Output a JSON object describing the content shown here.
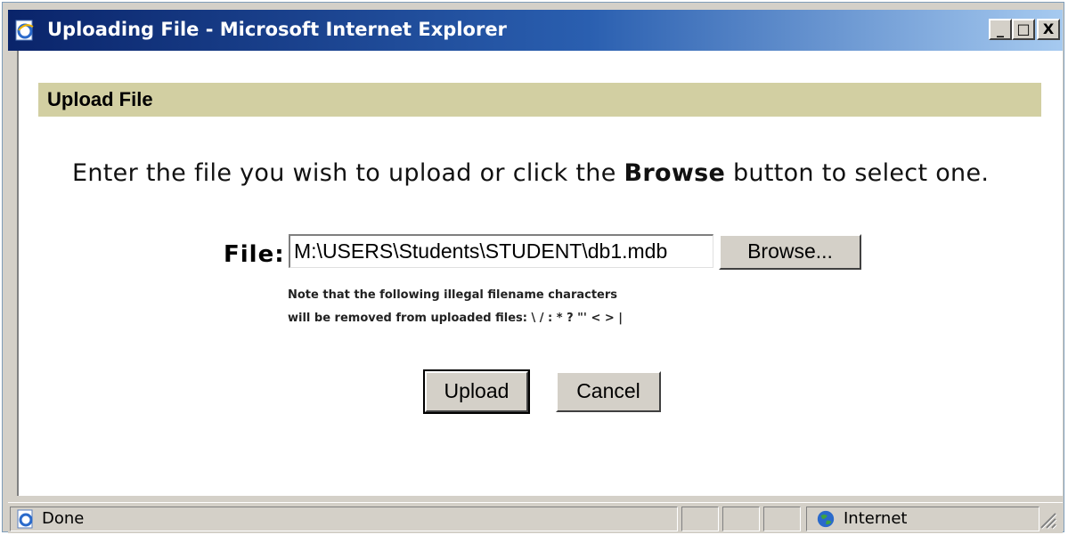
{
  "window": {
    "title": "Uploading File - Microsoft Internet Explorer",
    "minimize_label": "_",
    "maximize_label": "□",
    "close_label": "X"
  },
  "section": {
    "title": "Upload File"
  },
  "instruction": {
    "before": "Enter the file you wish to upload or click the ",
    "bold": "Browse",
    "after": " button to select one."
  },
  "file_field": {
    "label": "File:",
    "value": "M:\\USERS\\Students\\STUDENT\\db1.mdb"
  },
  "browse_button": {
    "label": "Browse..."
  },
  "note": {
    "line1": "Note that the following illegal filename characters",
    "line2": "will be removed from uploaded files: \\ / : * ? \"' < > |"
  },
  "actions": {
    "upload_label": "Upload",
    "cancel_label": "Cancel"
  },
  "statusbar": {
    "status": "Done",
    "zone": "Internet"
  },
  "colors": {
    "titlebar_start": "#0a246a",
    "section_header": "#d2cfa2",
    "window_chrome": "#d4d0c8"
  },
  "icons": {
    "title": "ie-page-icon",
    "status": "ie-page-icon",
    "zone": "globe-icon",
    "resize": "resize-grip-icon"
  }
}
